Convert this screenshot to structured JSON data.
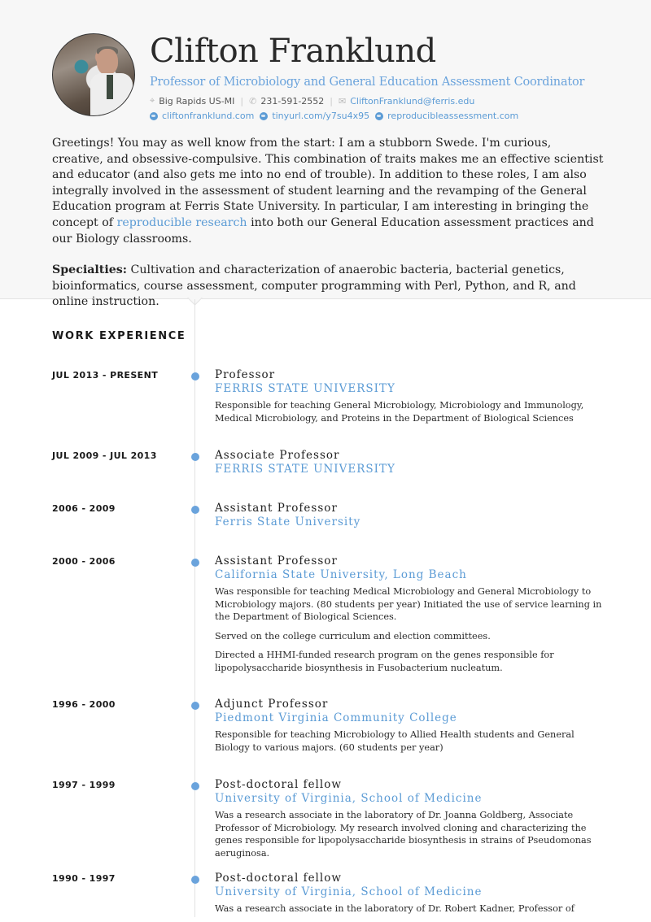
{
  "profile": {
    "name": "Clifton Franklund",
    "title": "Professor of Microbiology and General Education Assessment Coordinator",
    "location": "Big Rapids US-MI",
    "phone": "231-591-2552",
    "email": "CliftonFranklund@ferris.edu",
    "websites": [
      "cliftonfranklund.com",
      "tinyurl.com/y7su4x95",
      "reproducibleassessment.com"
    ]
  },
  "icons": {
    "location": "map-pin-icon",
    "phone": "phone-icon",
    "email": "envelope-icon",
    "website": "globe-icon"
  },
  "summary": {
    "paragraph_before_link": "Greetings! You may as well know from the start: I am a stubborn Swede. I'm curious, creative, and obsessive-compulsive. This combination of traits makes me an effective scientist and educator (and also gets me into no end of trouble). In addition to these roles, I am also integrally involved in the assessment of student learning and the revamping of the General Education program at Ferris State University. In particular, I am interesting in bringing the concept of ",
    "link_text": "reproducible research",
    "paragraph_after_link": " into both our General Education assessment practices and our Biology classrooms.",
    "specialties_label": "Specialties:",
    "specialties_text": " Cultivation and characterization of anaerobic bacteria, bacterial genetics, bioinformatics, course assessment, computer programming with Perl, Python, and R, and online instruction."
  },
  "work": {
    "heading": "WORK EXPERIENCE",
    "jobs": [
      {
        "dates": "JUL 2013 - PRESENT",
        "title": "Professor",
        "org": "FERRIS STATE UNIVERSITY",
        "desc": [
          "Responsible for teaching General Microbiology, Microbiology and Immunology, Medical Microbiology, and Proteins in the Department of Biological Sciences"
        ]
      },
      {
        "dates": "JUL 2009 - JUL 2013",
        "title": "Associate Professor",
        "org": "FERRIS STATE UNIVERSITY",
        "desc": []
      },
      {
        "dates": "2006 - 2009",
        "title": "Assistant Professor",
        "org": "Ferris State University",
        "desc": []
      },
      {
        "dates": "2000 - 2006",
        "title": "Assistant Professor",
        "org": "California State University, Long Beach",
        "desc": [
          "Was responsible for teaching Medical Microbiology and General Microbiology to Microbiology majors. (80 students per year) Initiated the use of service learning in the Department of Biological Sciences.",
          "Served on the college curriculum and election committees.",
          "Directed a HHMI-funded research program on the genes responsible for lipopolysaccharide biosynthesis in Fusobacterium nucleatum."
        ]
      },
      {
        "dates": "1996 - 2000",
        "title": "Adjunct Professor",
        "org": "Piedmont Virginia Community College",
        "desc": [
          "Responsible for teaching Microbiology to Allied Health students and General Biology to various majors. (60 students per year)"
        ]
      },
      {
        "dates": "1997 - 1999",
        "title": "Post-doctoral fellow",
        "org": "University of Virginia, School of Medicine",
        "desc": [
          "Was a research associate in the laboratory of Dr. Joanna Goldberg, Associate Professor of Microbiology. My research involved cloning and characterizing the genes responsible for lipopolysaccharide biosynthesis in strains of Pseudomonas aeruginosa."
        ]
      },
      {
        "dates": "1990 - 1997",
        "title": "Post-doctoral fellow",
        "org": "University of Virginia, School of Medicine",
        "desc": [
          "Was a research associate in the laboratory of Dr. Robert Kadner, Professor of"
        ]
      }
    ]
  },
  "colors": {
    "accent": "#5b9bd5",
    "header_bg": "#f7f7f7",
    "text": "#222222"
  }
}
